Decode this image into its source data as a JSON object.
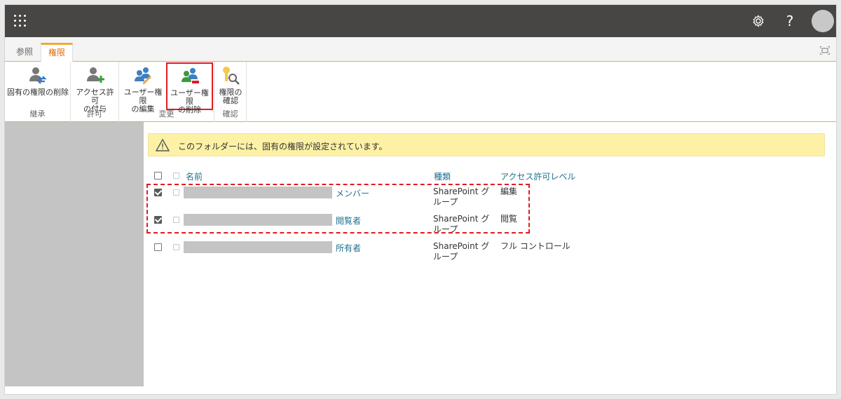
{
  "suitebar": {
    "waffle_icon": "waffle-icon",
    "settings_icon": "gear-icon",
    "help_label": "?"
  },
  "ribbon": {
    "tabs": [
      {
        "label": "参照"
      },
      {
        "label": "権限"
      }
    ],
    "groups": [
      {
        "label": "継承",
        "buttons": [
          {
            "label": "固有の権限の削除"
          }
        ]
      },
      {
        "label": "許可",
        "buttons": [
          {
            "label1": "アクセス許可",
            "label2": "の付与"
          }
        ]
      },
      {
        "label": "変更",
        "buttons": [
          {
            "label1": "ユーザー権限",
            "label2": "の編集"
          },
          {
            "label1": "ユーザー権限",
            "label2": "の削除"
          }
        ]
      },
      {
        "label": "確認",
        "buttons": [
          {
            "label1": "権限の",
            "label2": "確認"
          }
        ]
      }
    ]
  },
  "banner": {
    "message": "このフォルダーには、固有の権限が設定されています。"
  },
  "table": {
    "headers": {
      "name": "名前",
      "type": "種類",
      "level": "アクセス許可レベル"
    },
    "rows": [
      {
        "name": "メンバー",
        "type1": "SharePoint グ",
        "type2": "ループ",
        "level": "編集",
        "checked": true
      },
      {
        "name": "閲覧者",
        "type1": "SharePoint グ",
        "type2": "ループ",
        "level": "閲覧",
        "checked": true
      },
      {
        "name": "所有者",
        "type1": "SharePoint グ",
        "type2": "ループ",
        "level": "フル コントロール",
        "checked": false
      }
    ]
  },
  "colors": {
    "suitebar": "#484644",
    "accent": "#f2a73b",
    "tab_active_text": "#d86c12",
    "link": "#1e6f8e",
    "highlight": "#e11b22",
    "banner": "#fdf1a6"
  }
}
